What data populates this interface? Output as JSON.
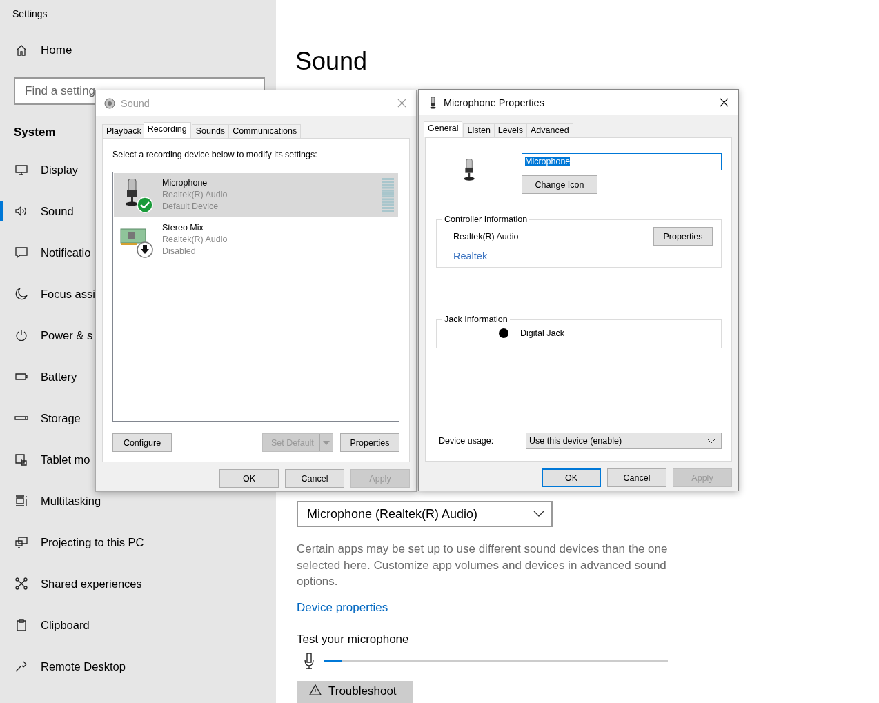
{
  "settings": {
    "title": "Settings",
    "home": "Home",
    "search": {
      "placeholder": "Find a setting"
    },
    "section": "System",
    "nav": [
      {
        "label": "Display",
        "selected": false
      },
      {
        "label": "Sound",
        "selected": true
      },
      {
        "label": "Notificatio",
        "selected": false
      },
      {
        "label": "Focus assi",
        "selected": false
      },
      {
        "label": "Power & s",
        "selected": false
      },
      {
        "label": "Battery",
        "selected": false
      },
      {
        "label": "Storage",
        "selected": false
      },
      {
        "label": "Tablet mo",
        "selected": false
      },
      {
        "label": "Multitasking",
        "selected": false
      },
      {
        "label": "Projecting to this PC",
        "selected": false
      },
      {
        "label": "Shared experiences",
        "selected": false
      },
      {
        "label": "Clipboard",
        "selected": false
      },
      {
        "label": "Remote Desktop",
        "selected": false
      }
    ]
  },
  "main": {
    "title": "Sound",
    "input_device": "Microphone (Realtek(R) Audio)",
    "note": "Certain apps may be set up to use different sound devices than the one selected here. Customize app volumes and devices in advanced sound options.",
    "link": "Device properties",
    "test_heading": "Test your microphone",
    "mic_test": {
      "level": 0.05
    },
    "troubleshoot": "Troubleshoot"
  },
  "sound_dialog": {
    "title": "Sound",
    "active": false,
    "tabs": [
      {
        "label": "Playback",
        "selected": false
      },
      {
        "label": "Recording",
        "selected": true
      },
      {
        "label": "Sounds",
        "selected": false
      },
      {
        "label": "Communications",
        "selected": false
      }
    ],
    "instruction": "Select a recording device below to modify its settings:",
    "devices": [
      {
        "name": "Microphone",
        "driver": "Realtek(R) Audio",
        "status": "Default Device",
        "kind": "microphone",
        "selected": true
      },
      {
        "name": "Stereo Mix",
        "driver": "Realtek(R) Audio",
        "status": "Disabled",
        "kind": "card",
        "selected": false
      }
    ],
    "buttons": [
      {
        "label": "Configure",
        "kind": "plain",
        "disabled": false
      },
      {
        "label": "Set Default",
        "kind": "split",
        "disabled": true
      },
      {
        "label": "Properties",
        "kind": "plain",
        "disabled": false
      }
    ],
    "footer": [
      {
        "label": "OK",
        "disabled": false,
        "focused": false
      },
      {
        "label": "Cancel",
        "disabled": false,
        "focused": false
      },
      {
        "label": "Apply",
        "disabled": true,
        "focused": false
      }
    ]
  },
  "properties_dialog": {
    "title": "Microphone Properties",
    "active": true,
    "tabs": [
      {
        "label": "General",
        "selected": true
      },
      {
        "label": "Listen",
        "selected": false
      },
      {
        "label": "Levels",
        "selected": false
      },
      {
        "label": "Advanced",
        "selected": false
      }
    ],
    "name_field": {
      "value": "Microphone",
      "text_selected": true
    },
    "change_icon": "Change Icon",
    "controller": {
      "heading": "Controller Information",
      "name": "Realtek(R) Audio",
      "button": "Properties",
      "link": "Realtek"
    },
    "jack": {
      "heading": "Jack Information",
      "label": "Digital Jack",
      "color": "#000000"
    },
    "usage_label": "Device usage:",
    "usage_value": "Use this device (enable)",
    "footer": [
      {
        "label": "OK",
        "disabled": false,
        "focused": true
      },
      {
        "label": "Cancel",
        "disabled": false,
        "focused": false
      },
      {
        "label": "Apply",
        "disabled": true,
        "focused": false
      }
    ]
  }
}
